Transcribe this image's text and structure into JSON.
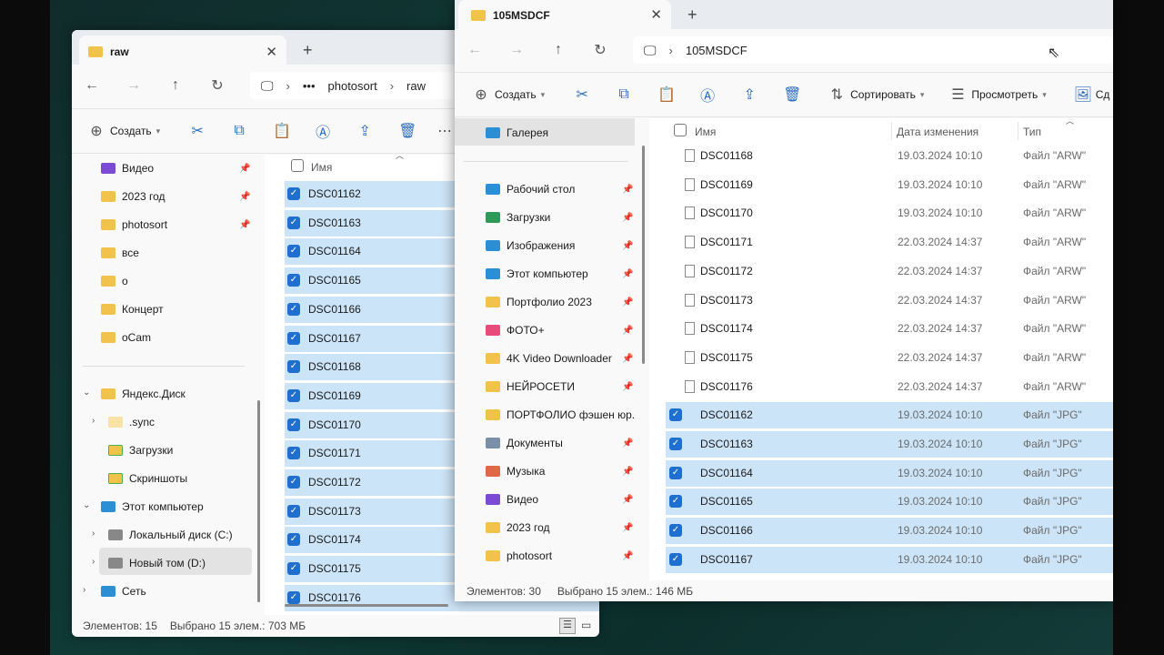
{
  "back_window": {
    "tab_title": "raw",
    "breadcrumb": [
      "•••",
      "photosort",
      "raw"
    ],
    "toolbar": {
      "create_label": "Создать"
    },
    "sidebar": {
      "pinned": [
        {
          "label": "Видео",
          "icon": "video-icon"
        },
        {
          "label": "2023 год",
          "icon": "folder-icon"
        },
        {
          "label": "photosort",
          "icon": "folder-icon"
        },
        {
          "label": "все",
          "icon": "folder-icon"
        },
        {
          "label": "о",
          "icon": "folder-icon"
        },
        {
          "label": "Концерт",
          "icon": "folder-icon"
        },
        {
          "label": "oCam",
          "icon": "folder-icon"
        }
      ],
      "tree": [
        {
          "label": "Яндекс.Диск",
          "icon": "folder-icon"
        },
        {
          "label": ".sync",
          "icon": "folder-icon"
        },
        {
          "label": "Загрузки",
          "icon": "sync-folder-icon"
        },
        {
          "label": "Скриншоты",
          "icon": "sync-folder-icon"
        },
        {
          "label": "Этот компьютер",
          "icon": "computer-icon"
        },
        {
          "label": "Локальный диск (C:)",
          "icon": "drive-icon"
        },
        {
          "label": "Новый том (D:)",
          "icon": "drive-icon"
        },
        {
          "label": "Сеть",
          "icon": "network-icon"
        }
      ]
    },
    "column_name": "Имя",
    "files": [
      "DSC01162",
      "DSC01163",
      "DSC01164",
      "DSC01165",
      "DSC01166",
      "DSC01167",
      "DSC01168",
      "DSC01169",
      "DSC01170",
      "DSC01171",
      "DSC01172",
      "DSC01173",
      "DSC01174",
      "DSC01175",
      "DSC01176"
    ],
    "status": {
      "count": "Элементов: 15",
      "selected": "Выбрано 15 элем.: 703 МБ"
    }
  },
  "front_window": {
    "tab_title": "105MSDCF",
    "breadcrumb": "105MSDCF",
    "toolbar": {
      "create_label": "Создать",
      "sort_label": "Сортировать",
      "view_label": "Просмотреть",
      "more_label": "Сд"
    },
    "sidebar": {
      "gallery": "Галерея",
      "items": [
        {
          "label": "Рабочий стол",
          "icon": "desktop-icon"
        },
        {
          "label": "Загрузки",
          "icon": "download-icon"
        },
        {
          "label": "Изображения",
          "icon": "pictures-icon"
        },
        {
          "label": "Этот компьютер",
          "icon": "computer-icon"
        },
        {
          "label": "Портфолио 2023",
          "icon": "folder-icon"
        },
        {
          "label": "ФОТО+",
          "icon": "app-icon"
        },
        {
          "label": "4K Video Downloader",
          "icon": "folder-icon"
        },
        {
          "label": "НЕЙРОСЕТИ",
          "icon": "folder-icon"
        },
        {
          "label": "ПОРТФОЛИО фэшен юр.",
          "icon": "folder-icon"
        },
        {
          "label": "Документы",
          "icon": "documents-icon"
        },
        {
          "label": "Музыка",
          "icon": "music-icon"
        },
        {
          "label": "Видео",
          "icon": "video-icon"
        },
        {
          "label": "2023 год",
          "icon": "folder-icon"
        },
        {
          "label": "photosort",
          "icon": "folder-icon"
        }
      ]
    },
    "columns": {
      "name": "Имя",
      "date": "Дата изменения",
      "type": "Тип"
    },
    "files": [
      {
        "name": "DSC01168",
        "date": "19.03.2024 10:10",
        "type": "Файл \"ARW\"",
        "selected": false
      },
      {
        "name": "DSC01169",
        "date": "19.03.2024 10:10",
        "type": "Файл \"ARW\"",
        "selected": false
      },
      {
        "name": "DSC01170",
        "date": "19.03.2024 10:10",
        "type": "Файл \"ARW\"",
        "selected": false
      },
      {
        "name": "DSC01171",
        "date": "22.03.2024 14:37",
        "type": "Файл \"ARW\"",
        "selected": false
      },
      {
        "name": "DSC01172",
        "date": "22.03.2024 14:37",
        "type": "Файл \"ARW\"",
        "selected": false
      },
      {
        "name": "DSC01173",
        "date": "22.03.2024 14:37",
        "type": "Файл \"ARW\"",
        "selected": false
      },
      {
        "name": "DSC01174",
        "date": "22.03.2024 14:37",
        "type": "Файл \"ARW\"",
        "selected": false
      },
      {
        "name": "DSC01175",
        "date": "22.03.2024 14:37",
        "type": "Файл \"ARW\"",
        "selected": false
      },
      {
        "name": "DSC01176",
        "date": "22.03.2024 14:37",
        "type": "Файл \"ARW\"",
        "selected": false
      },
      {
        "name": "DSC01162",
        "date": "19.03.2024 10:10",
        "type": "Файл \"JPG\"",
        "selected": true
      },
      {
        "name": "DSC01163",
        "date": "19.03.2024 10:10",
        "type": "Файл \"JPG\"",
        "selected": true
      },
      {
        "name": "DSC01164",
        "date": "19.03.2024 10:10",
        "type": "Файл \"JPG\"",
        "selected": true
      },
      {
        "name": "DSC01165",
        "date": "19.03.2024 10:10",
        "type": "Файл \"JPG\"",
        "selected": true
      },
      {
        "name": "DSC01166",
        "date": "19.03.2024 10:10",
        "type": "Файл \"JPG\"",
        "selected": true
      },
      {
        "name": "DSC01167",
        "date": "19.03.2024 10:10",
        "type": "Файл \"JPG\"",
        "selected": true
      }
    ],
    "status": {
      "count": "Элементов: 30",
      "selected": "Выбрано 15 элем.: 146 МБ"
    }
  },
  "colors": {
    "selection": "#cce4f7",
    "accent": "#1f6fd1",
    "folder": "#f2c34a"
  }
}
